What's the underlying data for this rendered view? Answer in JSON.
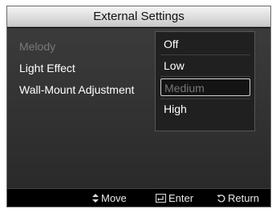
{
  "window": {
    "title": "External Settings"
  },
  "menu": {
    "items": [
      {
        "label": "Melody",
        "state": "disabled"
      },
      {
        "label": "Light Effect",
        "state": "enabled"
      },
      {
        "label": "Wall-Mount Adjustment",
        "state": "enabled"
      }
    ]
  },
  "dropdown": {
    "options": [
      {
        "label": "Off"
      },
      {
        "label": "Low"
      },
      {
        "label": "Medium",
        "state": "highlighted"
      },
      {
        "label": "High"
      }
    ]
  },
  "footer": {
    "move_label": "Move",
    "enter_label": "Enter",
    "return_label": "Return",
    "move_icon": "updown-arrow-icon",
    "enter_icon": "enter-icon",
    "return_icon": "return-icon"
  }
}
